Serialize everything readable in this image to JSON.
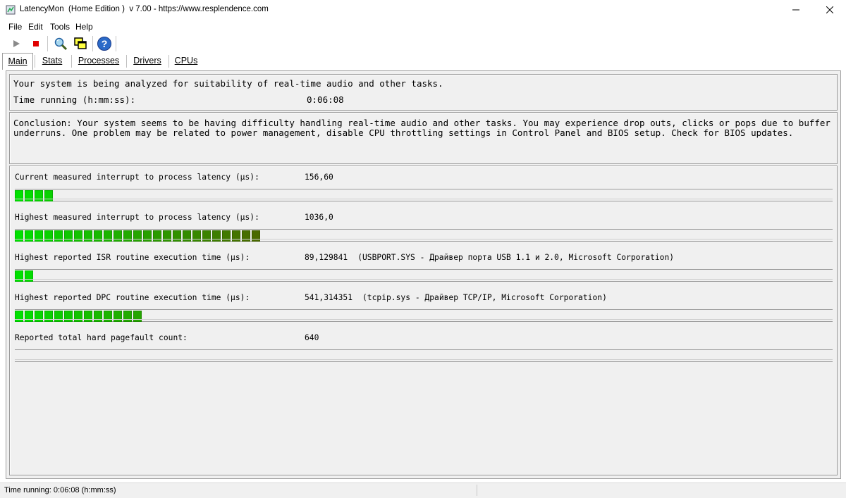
{
  "window": {
    "title": "LatencyMon  (Home Edition )  v 7.00 - https://www.resplendence.com"
  },
  "menu": [
    "File",
    "Edit",
    "Tools",
    "Help"
  ],
  "toolbar": {
    "icons": [
      "play-icon",
      "stop-icon",
      "search-icon",
      "windows-icon",
      "help-icon"
    ]
  },
  "tabs": [
    "Main",
    "Stats",
    "Processes",
    "Drivers",
    "CPUs"
  ],
  "analysis": {
    "line1": "Your system is being analyzed for suitability of real-time audio and other tasks.",
    "time_label": "Time running (h:mm:ss):",
    "time_value": "0:06:08"
  },
  "conclusion": "Conclusion: Your system seems to be having difficulty handling real-time audio and other tasks. You may experience drop outs, clicks or pops due to buffer underruns. One problem may be related to power management, disable CPU throttling settings in Control Panel and BIOS setup. Check for BIOS updates.",
  "metrics": [
    {
      "label": "Current measured interrupt to process latency (µs):",
      "value": "156,60",
      "detail": "",
      "segments": 4
    },
    {
      "label": "Highest measured interrupt to process latency (µs):",
      "value": "1036,0",
      "detail": "",
      "segments": 25
    },
    {
      "label": "Highest reported ISR routine execution time (µs):",
      "value": "89,129841",
      "detail": "(USBPORT.SYS - Драйвер порта USB 1.1 и 2.0, Microsoft Corporation)",
      "segments": 2
    },
    {
      "label": "Highest reported DPC routine execution time (µs):",
      "value": "541,314351",
      "detail": "(tcpip.sys - Драйвер TCP/IP, Microsoft Corporation)",
      "segments": 13
    },
    {
      "label": "Reported total hard pagefault count:",
      "value": "640",
      "detail": "",
      "segments": 0
    }
  ],
  "statusbar": {
    "text": "Time running: 0:06:08  (h:mm:ss)"
  },
  "colors": {
    "bar_start": "#00e000",
    "bar_end": "#4a6a00"
  }
}
